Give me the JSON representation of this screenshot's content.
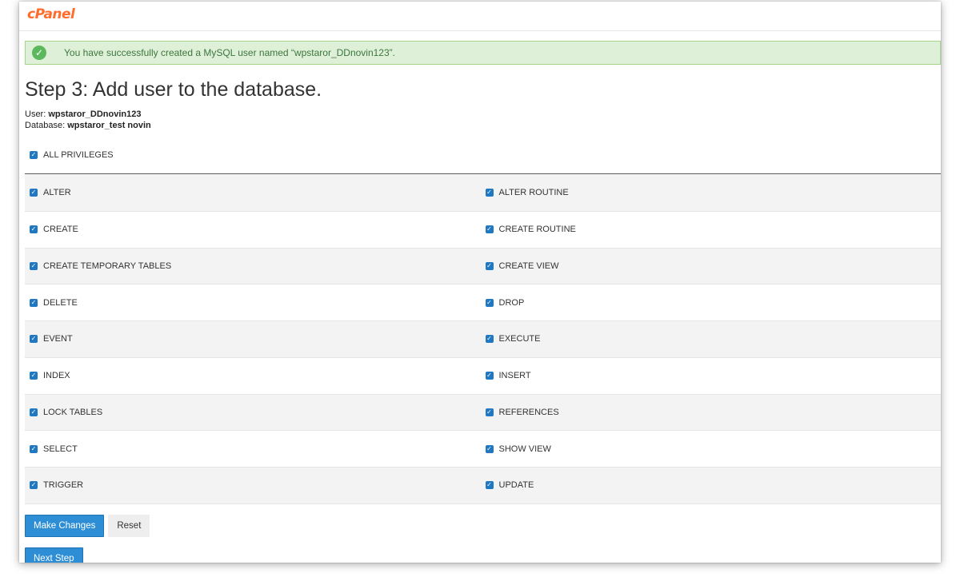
{
  "app": {
    "logo": "cPanel"
  },
  "alert": {
    "message": "You have successfully created a MySQL user named “wpstaror_DDnovin123”."
  },
  "page": {
    "title": "Step 3: Add user to the database.",
    "user_label": "User:",
    "user_value": "wpstaror_DDnovin123",
    "database_label": "Database:",
    "database_value": "wpstaror_test novin"
  },
  "all_privileges": {
    "label": "ALL PRIVILEGES",
    "checked": true
  },
  "privileges": [
    {
      "left": "ALTER",
      "right": "ALTER ROUTINE"
    },
    {
      "left": "CREATE",
      "right": "CREATE ROUTINE"
    },
    {
      "left": "CREATE TEMPORARY TABLES",
      "right": "CREATE VIEW"
    },
    {
      "left": "DELETE",
      "right": "DROP"
    },
    {
      "left": "EVENT",
      "right": "EXECUTE"
    },
    {
      "left": "INDEX",
      "right": "INSERT"
    },
    {
      "left": "LOCK TABLES",
      "right": "REFERENCES"
    },
    {
      "left": "SELECT",
      "right": "SHOW VIEW"
    },
    {
      "left": "TRIGGER",
      "right": "UPDATE"
    }
  ],
  "buttons": {
    "make_changes": "Make Changes",
    "reset": "Reset",
    "next_step": "Next Step"
  },
  "colors": {
    "accent": "#2d8ed6",
    "checkbox": "#1f78c1",
    "success_bg": "#dff0d8",
    "brand": "#ff6c2c"
  }
}
